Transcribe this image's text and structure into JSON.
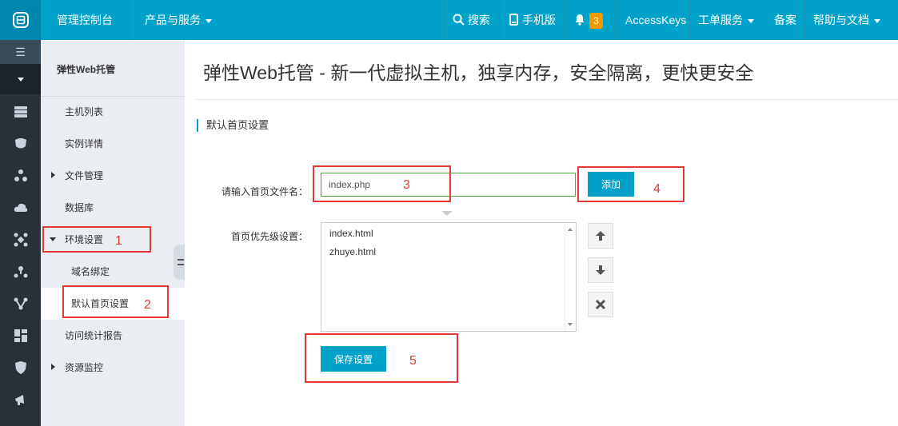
{
  "topbar": {
    "console": "管理控制台",
    "products": "产品与服务",
    "search": "搜索",
    "mobile": "手机版",
    "notification_count": "3",
    "accesskeys": "AccessKeys",
    "tickets": "工单服务",
    "beian": "备案",
    "help": "帮助与文档"
  },
  "sidebar": {
    "title": "弹性Web托管",
    "items": [
      {
        "label": "主机列表"
      },
      {
        "label": "实例详情"
      },
      {
        "label": "文件管理"
      },
      {
        "label": "数据库"
      },
      {
        "label": "环境设置"
      },
      {
        "label": "域名绑定"
      },
      {
        "label": "默认首页设置"
      },
      {
        "label": "访问统计报告"
      },
      {
        "label": "资源监控"
      }
    ]
  },
  "main": {
    "page_title": "弹性Web托管 - 新一代虚拟主机，独享内存，安全隔离，更快更安全",
    "section_title": "默认首页设置",
    "filename_label": "请输入首页文件名：",
    "filename_value": "index.php",
    "add_button": "添加",
    "priority_label": "首页优先级设置：",
    "priority_list": [
      "index.html",
      "zhuye.html"
    ],
    "save_button": "保存设置"
  },
  "annotations": [
    "1",
    "2",
    "3",
    "4",
    "5"
  ],
  "colors": {
    "topbar": "#00a2ca",
    "rail": "#293038",
    "sidebar": "#eaedf1",
    "primary_button": "#00a2ca",
    "annotation": "#e53935",
    "badge": "#f39800"
  },
  "icons": {
    "logo": "aliyun-logo-icon",
    "search": "search-icon",
    "mobile": "mobile-icon",
    "bell": "bell-icon",
    "move_up": "arrow-up-icon",
    "move_down": "arrow-down-icon",
    "remove": "close-icon"
  }
}
